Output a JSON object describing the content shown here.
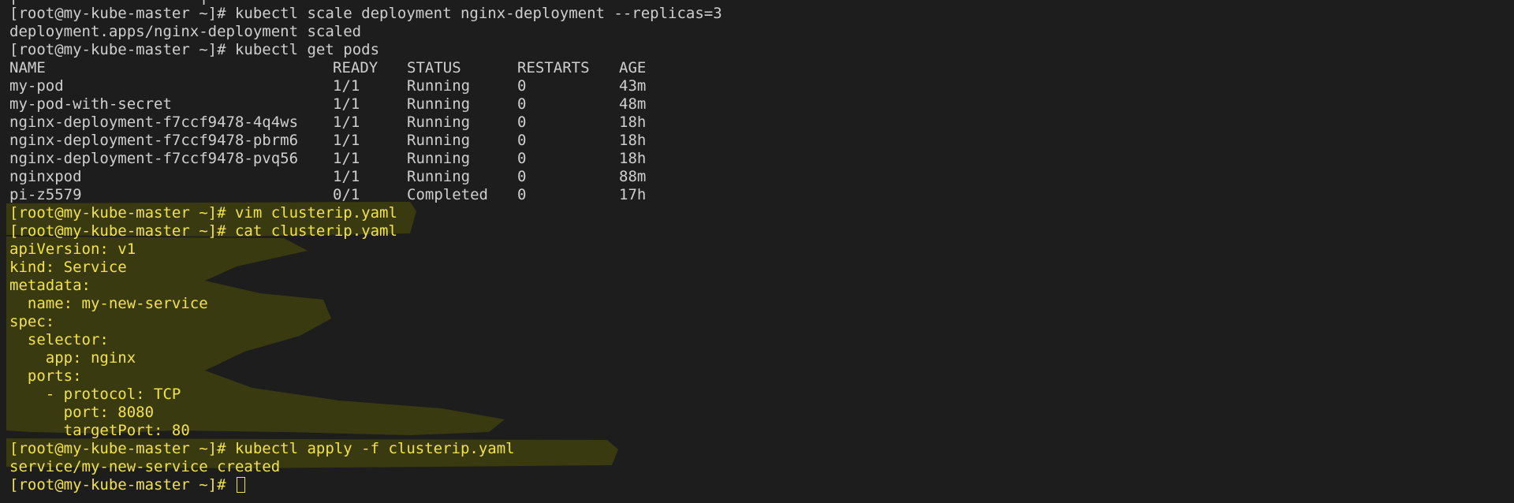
{
  "terminal": {
    "partial_top": "[                    ]                            ",
    "prompt": "[root@my-kube-master ~]# ",
    "commands": {
      "scale": "kubectl scale deployment nginx-deployment --replicas=3",
      "scale_out": "deployment.apps/nginx-deployment scaled",
      "get_pods": "kubectl get pods",
      "vim": "vim clusterip.yaml",
      "cat": "cat clusterip.yaml",
      "apply": "kubectl apply -f clusterip.yaml",
      "apply_out": "service/my-new-service created"
    },
    "pods_table": {
      "headers": [
        "NAME",
        "READY",
        "STATUS",
        "RESTARTS",
        "AGE"
      ],
      "rows": [
        [
          "my-pod",
          "1/1",
          "Running",
          "0",
          "43m"
        ],
        [
          "my-pod-with-secret",
          "1/1",
          "Running",
          "0",
          "48m"
        ],
        [
          "nginx-deployment-f7ccf9478-4q4ws",
          "1/1",
          "Running",
          "0",
          "18h"
        ],
        [
          "nginx-deployment-f7ccf9478-pbrm6",
          "1/1",
          "Running",
          "0",
          "18h"
        ],
        [
          "nginx-deployment-f7ccf9478-pvq56",
          "1/1",
          "Running",
          "0",
          "18h"
        ],
        [
          "nginxpod",
          "1/1",
          "Running",
          "0",
          "88m"
        ],
        [
          "pi-z5579",
          "0/1",
          "Completed",
          "0",
          "17h"
        ]
      ]
    },
    "yaml": [
      "apiVersion: v1",
      "kind: Service",
      "metadata:",
      "  name: my-new-service",
      "spec:",
      "  selector:",
      "    app: nginx",
      "  ports:",
      "    - protocol: TCP",
      "      port: 8080",
      "      targetPort: 80"
    ],
    "colors": {
      "background": "#1d1d1d",
      "text": "#cfcfcf",
      "highlight_text": "#f2e24c",
      "highlight_marker": "#3a3a10"
    }
  }
}
